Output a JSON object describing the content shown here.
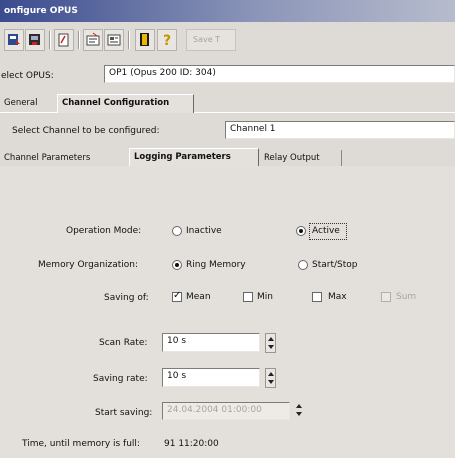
{
  "window": {
    "title": "onfigure OPUS"
  },
  "toolbar": {
    "icons": [
      "toolbar-icon-1",
      "toolbar-icon-2",
      "toolbar-icon-3",
      "toolbar-icon-4",
      "toolbar-icon-5",
      "book-icon",
      "help-icon"
    ],
    "disabled_button_label": "Save T"
  },
  "select_opus": {
    "label": "elect OPUS:",
    "value": "OP1 (Opus 200 ID: 304)"
  },
  "top_tabs": [
    "General",
    "Channel Configuration"
  ],
  "channel_select": {
    "label": "Select Channel to be configured:",
    "value": "Channel 1"
  },
  "sub_tabs": [
    "Channel Parameters",
    "Logging Parameters",
    "Relay Output"
  ],
  "operation_mode": {
    "label": "Operation Mode:",
    "options": [
      "Inactive",
      "Active"
    ],
    "selected": "Active"
  },
  "memory_org": {
    "label": "Memory Organization:",
    "options": [
      "Ring Memory",
      "Start/Stop"
    ],
    "selected": "Ring Memory"
  },
  "saving_of": {
    "label": "Saving of:",
    "options": [
      {
        "label": "Mean",
        "checked": true,
        "enabled": true
      },
      {
        "label": "Min",
        "checked": false,
        "enabled": true
      },
      {
        "label": "Max",
        "checked": false,
        "enabled": true
      },
      {
        "label": "Sum",
        "checked": false,
        "enabled": false
      }
    ]
  },
  "scan_rate": {
    "label": "Scan Rate:",
    "value": "10 s"
  },
  "saving_rate": {
    "label": "Saving rate:",
    "value": "10 s"
  },
  "start_saving": {
    "label": "Start saving:",
    "value": "24.04.2004 01:00:00"
  },
  "memory_time": {
    "label": "Time, until memory is full:",
    "value": "91 11:20:00"
  },
  "colors": {
    "titlebar": "#3a4b8e",
    "panel": "#e3e0db"
  }
}
